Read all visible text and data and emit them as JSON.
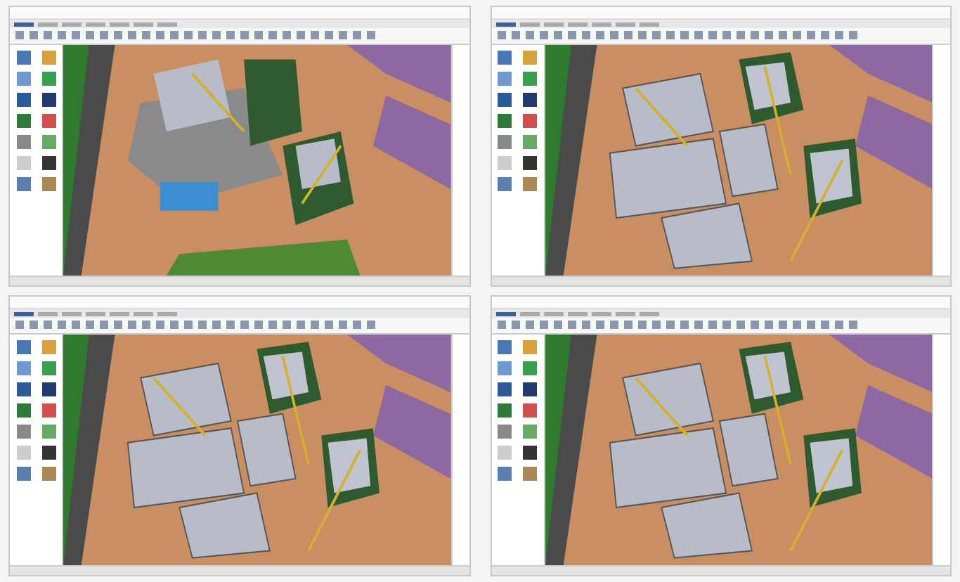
{
  "windows": [
    {
      "kind": "site",
      "tabs": [
        {
          "selected": true
        },
        {
          "selected": false
        },
        {
          "selected": false
        },
        {
          "selected": false
        },
        {
          "selected": false
        },
        {
          "selected": false
        },
        {
          "selected": false
        }
      ]
    },
    {
      "kind": "roofs",
      "tabs": [
        {
          "selected": true
        },
        {
          "selected": false
        },
        {
          "selected": false
        },
        {
          "selected": false
        },
        {
          "selected": false
        },
        {
          "selected": false
        },
        {
          "selected": false
        }
      ]
    },
    {
      "kind": "roofs",
      "tabs": [
        {
          "selected": true
        },
        {
          "selected": false
        },
        {
          "selected": false
        },
        {
          "selected": false
        },
        {
          "selected": false
        },
        {
          "selected": false
        },
        {
          "selected": false
        }
      ]
    },
    {
      "kind": "roofs",
      "tabs": [
        {
          "selected": true
        },
        {
          "selected": false
        },
        {
          "selected": false
        },
        {
          "selected": false
        },
        {
          "selected": false
        },
        {
          "selected": false
        },
        {
          "selected": false
        }
      ]
    }
  ]
}
